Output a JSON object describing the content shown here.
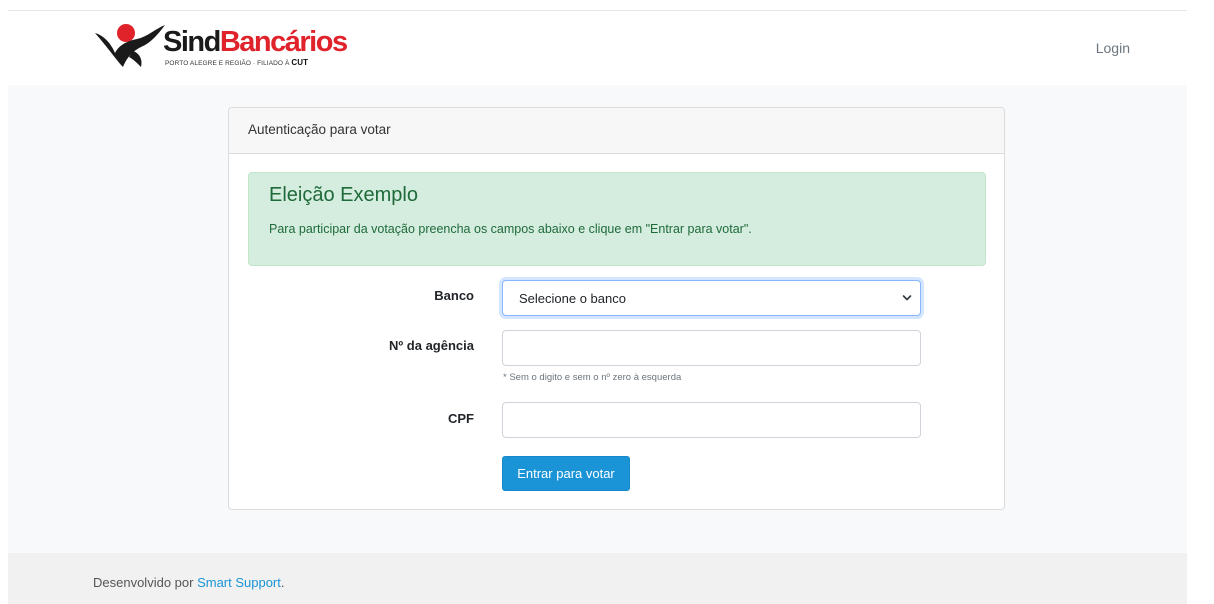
{
  "header": {
    "logo": {
      "brand_part1": "Sind",
      "brand_part2": "Bancários",
      "subtitle": "PORTO ALEGRE E REGIÃO · FILIADO À",
      "subtitle_cut": "CUT"
    },
    "login_label": "Login"
  },
  "card": {
    "header_title": "Autenticação para votar",
    "alert": {
      "title": "Eleição Exemplo",
      "text": "Para participar da votação preencha os campos abaixo e clique em \"Entrar para votar\"."
    },
    "form": {
      "bank_label": "Banco",
      "bank_selected": "Selecione o banco",
      "agency_label": "Nº da agência",
      "agency_value": "",
      "agency_help": "* Sem o digito e sem o nº zero à esquerda",
      "cpf_label": "CPF",
      "cpf_value": "",
      "submit_label": "Entrar para votar"
    }
  },
  "footer": {
    "text": "Desenvolvido por ",
    "link_text": "Smart Support",
    "suffix": "."
  },
  "colors": {
    "brand_red": "#e0222b",
    "primary_button": "#1a94d6",
    "alert_background": "#d4eddf",
    "alert_text": "#1f6a3a"
  }
}
